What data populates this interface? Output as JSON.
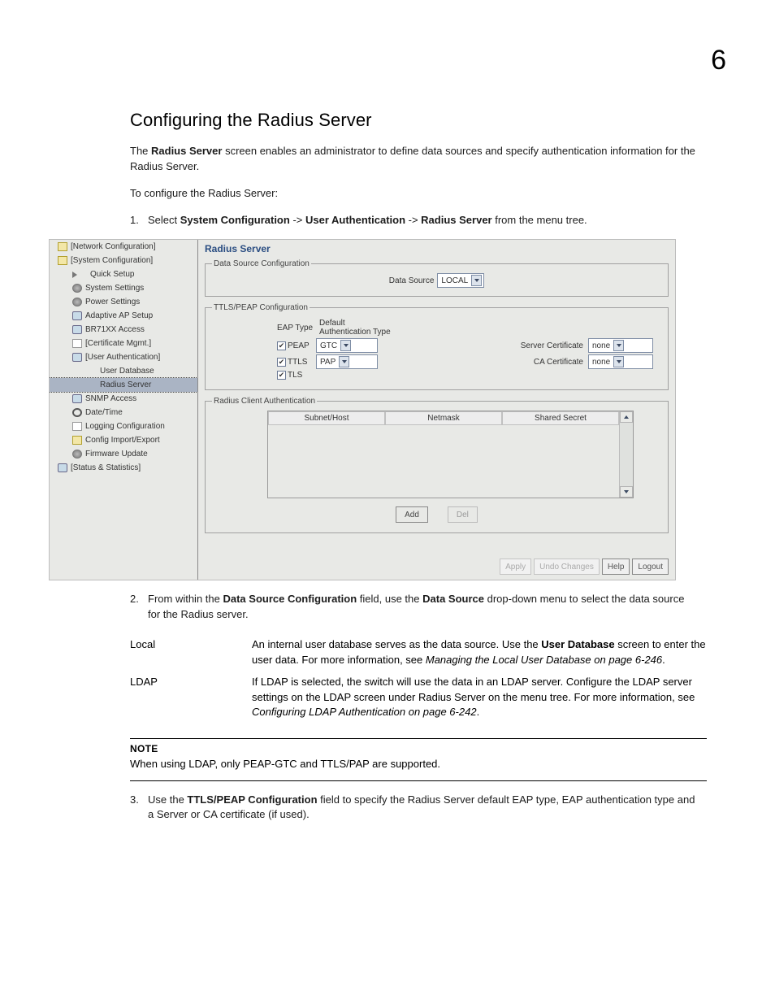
{
  "page": {
    "number": "6"
  },
  "heading": "Configuring the Radius Server",
  "intro": {
    "p1_pre": "The ",
    "p1_b1": "Radius Server",
    "p1_post": " screen enables an administrator to define data sources and specify authentication information for the Radius Server.",
    "p2": "To configure the Radius Server:"
  },
  "step1": {
    "num": "1.",
    "pre": "Select ",
    "b1": "System Configuration",
    "mid1": " -> ",
    "b2": "User Authentication",
    "mid2": " -> ",
    "b3": "Radius Server",
    "post": " from the menu tree."
  },
  "app": {
    "title": "Radius Server",
    "tree": [
      {
        "level": "l1",
        "icon": "icon-folder",
        "label": "[Network Configuration]"
      },
      {
        "level": "l1",
        "icon": "icon-folder",
        "label": "[System Configuration]"
      },
      {
        "level": "l2",
        "icon": "icon-arrow",
        "label": "Quick Setup"
      },
      {
        "level": "l2",
        "icon": "icon-gear",
        "label": "System Settings"
      },
      {
        "level": "l2",
        "icon": "icon-gear",
        "label": "Power Settings"
      },
      {
        "level": "l2",
        "icon": "icon-db",
        "label": "Adaptive AP Setup"
      },
      {
        "level": "l2",
        "icon": "icon-db",
        "label": "BR71XX Access"
      },
      {
        "level": "l2",
        "icon": "icon-file",
        "label": "[Certificate Mgmt.]"
      },
      {
        "level": "l2",
        "icon": "icon-db",
        "label": "[User Authentication]"
      },
      {
        "level": "l3",
        "icon": "",
        "label": "User Database"
      },
      {
        "level": "l3",
        "icon": "",
        "label": "Radius Server",
        "selected": true
      },
      {
        "level": "l2",
        "icon": "icon-db",
        "label": "SNMP Access"
      },
      {
        "level": "l2",
        "icon": "icon-clock",
        "label": "Date/Time"
      },
      {
        "level": "l2",
        "icon": "icon-file",
        "label": "Logging Configuration"
      },
      {
        "level": "l2",
        "icon": "icon-folder",
        "label": "Config Import/Export"
      },
      {
        "level": "l2",
        "icon": "icon-gear",
        "label": "Firmware Update"
      },
      {
        "level": "l1",
        "icon": "icon-db",
        "label": "[Status & Statistics]"
      }
    ],
    "ds_group": "Data Source Configuration",
    "ds_label": "Data Source",
    "ds_value": "LOCAL",
    "tp_group": "TTLS/PEAP Configuration",
    "tp_header_l": "EAP Type",
    "tp_header_r": "Default Authentication Type",
    "peap_label": "PEAP",
    "peap_auth_value": "GTC",
    "ttls_label": "TTLS",
    "ttls_auth_value": "PAP",
    "tls_label": "TLS",
    "server_cert_label": "Server Certificate",
    "server_cert_value": "none",
    "ca_cert_label": "CA Certificate",
    "ca_cert_value": "none",
    "client_group": "Radius Client Authentication",
    "client_cols": [
      "Subnet/Host",
      "Netmask",
      "Shared Secret"
    ],
    "add_btn": "Add",
    "del_btn": "Del",
    "footer": [
      "Apply",
      "Undo Changes",
      "Help",
      "Logout"
    ]
  },
  "step2": {
    "num": "2.",
    "pre": "From within the ",
    "b1": "Data Source Configuration",
    "mid": " field, use the ",
    "b2": "Data Source",
    "post": " drop-down menu to select the data source for the Radius server."
  },
  "defs": [
    {
      "term": "Local",
      "desc_pre": "An internal user database serves as the data source. Use the ",
      "desc_b": "User Database",
      "desc_mid": " screen to enter the user data. For more information, see ",
      "desc_em": "Managing the Local User Database on page 6-246",
      "desc_post": "."
    },
    {
      "term": "LDAP",
      "desc_pre": "If LDAP is selected, the switch will use the data in an LDAP server. Configure the LDAP server settings on the LDAP screen under Radius Server on the menu tree. For more information, see ",
      "desc_b": "",
      "desc_mid": "",
      "desc_em": "Configuring LDAP Authentication on page 6-242",
      "desc_post": "."
    }
  ],
  "note": {
    "label": "NOTE",
    "text": "When using LDAP, only PEAP-GTC and TTLS/PAP are supported."
  },
  "step3": {
    "num": "3.",
    "pre": "Use the ",
    "b1": "TTLS/PEAP Configuration",
    "post": " field to specify the Radius Server default EAP type, EAP authentication type and a Server or CA certificate (if used)."
  }
}
